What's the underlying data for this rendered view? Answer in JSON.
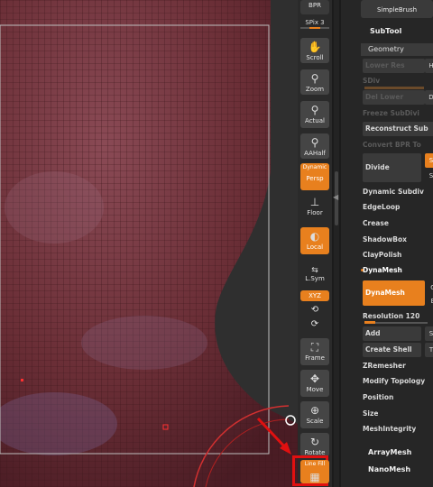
{
  "canvas": {
    "mesh_color": "#7a3a40",
    "grid_color": "#4a1f24"
  },
  "shelf": {
    "top_button": "BPR",
    "spix": "SPix 3",
    "buttons": [
      {
        "key": "scroll",
        "label": "Scroll",
        "icon": "✋",
        "active": false
      },
      {
        "key": "zoom",
        "label": "Zoom",
        "icon": "🔍",
        "active": false
      },
      {
        "key": "actual",
        "label": "Actual",
        "icon": "🔍",
        "active": false
      },
      {
        "key": "aahalf",
        "label": "AAHalf",
        "icon": "🔍",
        "active": false
      },
      {
        "key": "persp",
        "label": "Persp",
        "icon": "Dynamic",
        "active": true
      },
      {
        "key": "floor",
        "label": "Floor",
        "icon": "⊥",
        "active": false
      },
      {
        "key": "local",
        "label": "Local",
        "icon": "●",
        "active": true
      },
      {
        "key": "lsym",
        "label": "L.Sym",
        "icon": "⇆",
        "active": false
      },
      {
        "key": "xyz",
        "label": "XYZ",
        "icon": "",
        "active": true
      },
      {
        "key": "frame",
        "label": "Frame",
        "icon": "⛶",
        "active": false
      },
      {
        "key": "move",
        "label": "Move",
        "icon": "✥",
        "active": false
      },
      {
        "key": "scale",
        "label": "Scale",
        "icon": "⊕",
        "active": false
      },
      {
        "key": "rotate",
        "label": "Rotate",
        "icon": "↻",
        "active": false
      },
      {
        "key": "linefill",
        "label": "Line Fill",
        "icon": "▦",
        "active": true
      }
    ]
  },
  "panel": {
    "top_button": "SimpleBrush",
    "subtool": "SubTool",
    "geometry": "Geometry",
    "lower_res": "Lower Res",
    "sdiv": "SDiv",
    "del_lower": "Del Lower",
    "freeze": "Freeze SubDivi",
    "reconstruct": "Reconstruct Sub",
    "convert": "Convert BPR To",
    "divide": "Divide",
    "dynamic_subdiv": "Dynamic Subdiv",
    "edgeloop": "EdgeLoop",
    "crease": "Crease",
    "shadowbox": "ShadowBox",
    "claypolish": "ClayPolish",
    "dynamesh_title": "DynaMesh",
    "dynamesh_btn": "DynaMesh",
    "resolution": "Resolution 120",
    "add": "Add",
    "create_shell": "Create Shell",
    "zremesher": "ZRemesher",
    "modify_topology": "Modify Topology",
    "position": "Position",
    "size": "Size",
    "meshintegrity": "MeshIntegrity",
    "arraymesh": "ArrayMesh",
    "nanomesh": "NanoMesh"
  },
  "annotation": {
    "arrow_color": "#e01010",
    "highlight_color": "#e01010"
  }
}
